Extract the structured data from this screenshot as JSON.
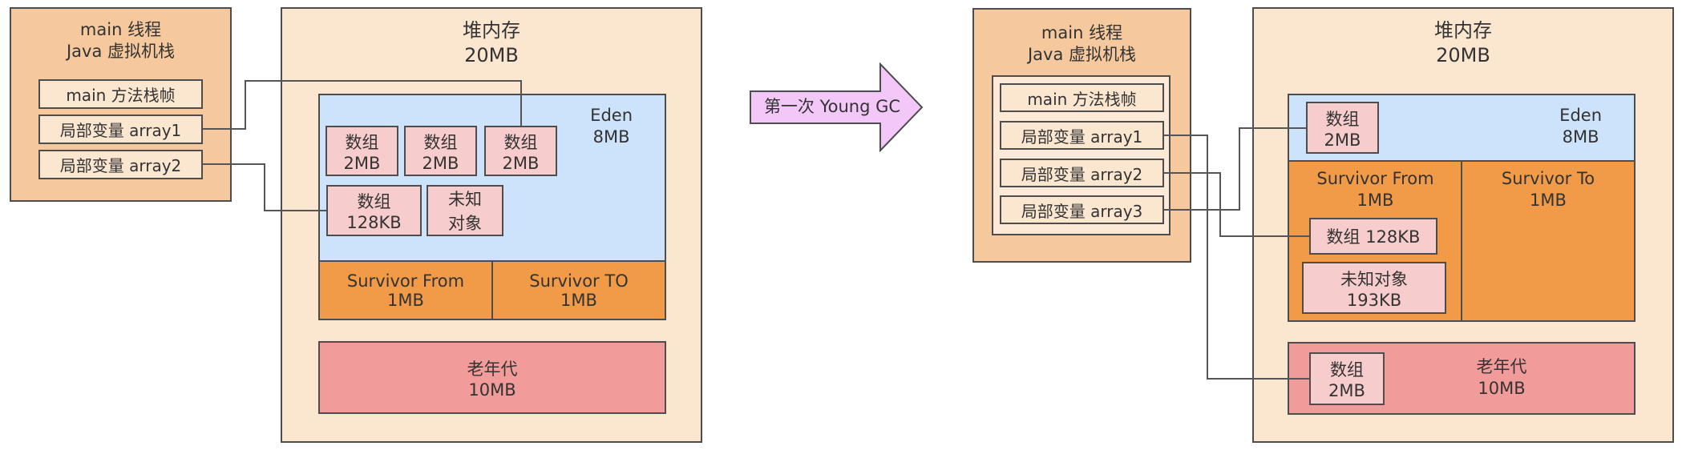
{
  "gc_label": "第一次 Young GC",
  "left": {
    "stack": {
      "title": "main 线程\nJava 虚拟机栈",
      "frame": "main 方法栈帧",
      "var1": "局部变量 array1",
      "var2": "局部变量 array2"
    },
    "heap": {
      "title": "堆内存\n20MB",
      "eden": {
        "label": "Eden\n8MB",
        "objects": [
          "数组\n2MB",
          "数组\n2MB",
          "数组\n2MB",
          "数组\n128KB",
          "未知\n对象"
        ]
      },
      "survivor_from": "Survivor From\n1MB",
      "survivor_to": "Survivor TO\n1MB",
      "old": "老年代\n10MB"
    }
  },
  "right": {
    "stack": {
      "title": "main 线程\nJava 虚拟机栈",
      "frame": "main 方法栈帧",
      "var1": "局部变量 array1",
      "var2": "局部变量 array2",
      "var3": "局部变量 array3"
    },
    "heap": {
      "title": "堆内存\n20MB",
      "eden": {
        "label": "Eden\n8MB",
        "object": "数组\n2MB"
      },
      "survivor_from": {
        "label": "Survivor From\n1MB",
        "obj1": "数组 128KB",
        "obj2": "未知对象\n193KB"
      },
      "survivor_to": "Survivor To\n1MB",
      "old": {
        "label": "老年代\n10MB",
        "object": "数组\n2MB"
      }
    }
  }
}
